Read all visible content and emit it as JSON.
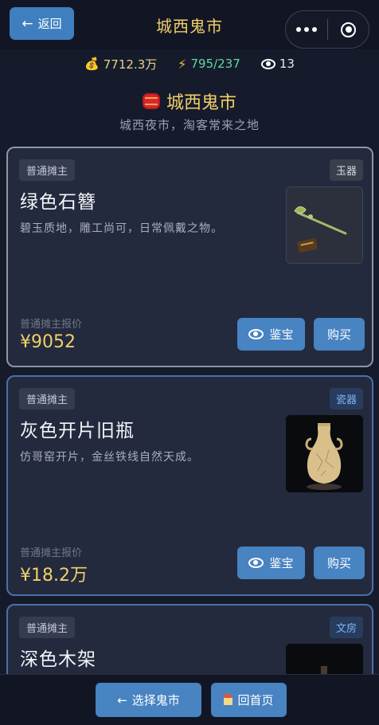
{
  "header": {
    "back_label": "返回",
    "title": "城西鬼市"
  },
  "stats": {
    "money": "7712.3万",
    "energy": "795/237",
    "views": "13"
  },
  "market": {
    "name": "城西鬼市",
    "subtitle": "城西夜市，淘客常来之地"
  },
  "items": [
    {
      "seller": "普通摊主",
      "category": "玉器",
      "name": "绿色石簪",
      "description": "碧玉质地，雕工尚可，日常佩戴之物。",
      "price_label": "普通摊主报价",
      "price": "¥9052",
      "appraise_label": "鉴宝",
      "buy_label": "购买"
    },
    {
      "seller": "普通摊主",
      "category": "瓷器",
      "name": "灰色开片旧瓶",
      "description": "仿哥窑开片，金丝铁线自然天成。",
      "price_label": "普通摊主报价",
      "price": "¥18.2万",
      "appraise_label": "鉴宝",
      "buy_label": "购买"
    },
    {
      "seller": "普通摊主",
      "category": "文房",
      "name": "深色木架"
    }
  ],
  "bottom": {
    "select_market_label": "选择鬼市",
    "home_label": "回首页"
  },
  "colors": {
    "accent_gold": "#f2cf6a",
    "button_blue": "#4883c2",
    "background": "#161b2b",
    "card": "#232a3d"
  }
}
